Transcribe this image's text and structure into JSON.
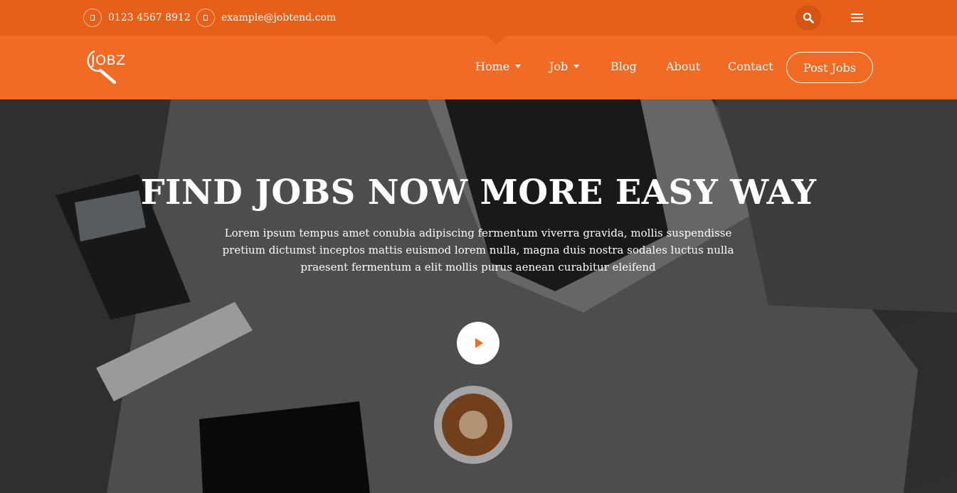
{
  "topbar": {
    "phone": "0123 4567 8912",
    "email": "example@jobtend.com"
  },
  "brand": {
    "logo_text": "JOBZ"
  },
  "nav": {
    "items": [
      {
        "label": "Home"
      },
      {
        "label": "Job"
      },
      {
        "label": "Blog"
      },
      {
        "label": "About"
      },
      {
        "label": "Contact"
      }
    ],
    "cta_label": "Post Jobs"
  },
  "hero": {
    "title": "FIND JOBS NOW MORE EASY WAY",
    "description": "Lorem ipsum tempus amet conubia adipiscing fermentum viverra gravida, mollis suspendisse pretium dictumst inceptos mattis euismod lorem nulla, magna duis nostra sodales luctus nulla praesent fermentum a elit mollis purus aenean curabitur eleifend"
  },
  "colors": {
    "topbar": "#e85f18",
    "navbar": "#f26b25",
    "accent": "#f26b25"
  },
  "icons": {
    "phone": "phone-icon",
    "email": "envelope-icon",
    "search": "search-icon",
    "menu": "hamburger-menu-icon",
    "play": "play-icon",
    "logo": "magnifier-logo-icon"
  }
}
